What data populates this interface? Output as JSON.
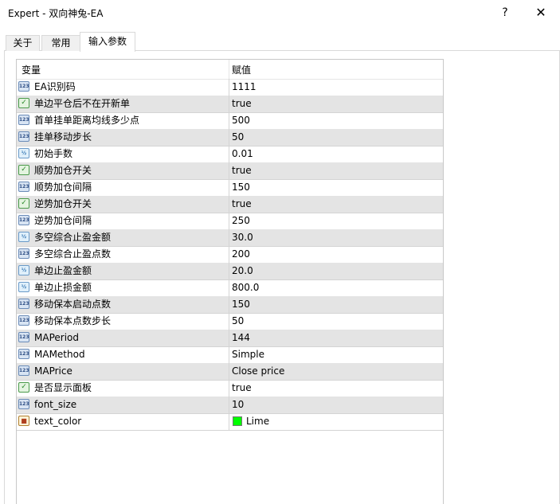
{
  "window": {
    "title": "Expert - 双向神兔-EA",
    "help_label": "?",
    "close_label": "✕"
  },
  "tabs": [
    {
      "label": "关于"
    },
    {
      "label": "常用"
    },
    {
      "label": "输入参数"
    }
  ],
  "grid": {
    "columns": {
      "variable": "变量",
      "value": "赋值"
    },
    "rows": [
      {
        "icon": "integer-icon",
        "name": "EA识别码",
        "value": "1111"
      },
      {
        "icon": "bool-icon",
        "name": "单边平仓后不在开新单",
        "value": "true"
      },
      {
        "icon": "integer-icon",
        "name": "首单挂单距离均线多少点",
        "value": "500"
      },
      {
        "icon": "integer-icon",
        "name": "挂单移动步长",
        "value": "50"
      },
      {
        "icon": "double-icon",
        "name": "初始手数",
        "value": "0.01"
      },
      {
        "icon": "bool-icon",
        "name": "顺势加仓开关",
        "value": "true"
      },
      {
        "icon": "integer-icon",
        "name": "顺势加仓间隔",
        "value": "150"
      },
      {
        "icon": "bool-icon",
        "name": "逆势加仓开关",
        "value": "true"
      },
      {
        "icon": "integer-icon",
        "name": "逆势加仓间隔",
        "value": "250"
      },
      {
        "icon": "double-icon",
        "name": "多空综合止盈金额",
        "value": "30.0"
      },
      {
        "icon": "integer-icon",
        "name": "多空综合止盈点数",
        "value": "200"
      },
      {
        "icon": "double-icon",
        "name": "单边止盈金额",
        "value": "20.0"
      },
      {
        "icon": "double-icon",
        "name": "单边止损金额",
        "value": "800.0"
      },
      {
        "icon": "integer-icon",
        "name": "移动保本启动点数",
        "value": "150"
      },
      {
        "icon": "integer-icon",
        "name": "移动保本点数步长",
        "value": "50"
      },
      {
        "icon": "integer-icon",
        "name": "MAPeriod",
        "value": "144"
      },
      {
        "icon": "integer-icon",
        "name": "MAMethod",
        "value": "Simple"
      },
      {
        "icon": "integer-icon",
        "name": "MAPrice",
        "value": "Close price"
      },
      {
        "icon": "bool-icon",
        "name": "是否显示面板",
        "value": "true"
      },
      {
        "icon": "integer-icon",
        "name": "font_size",
        "value": "10"
      },
      {
        "icon": "color-icon",
        "name": "text_color",
        "value": "Lime",
        "swatch": "#00ff00"
      }
    ]
  }
}
